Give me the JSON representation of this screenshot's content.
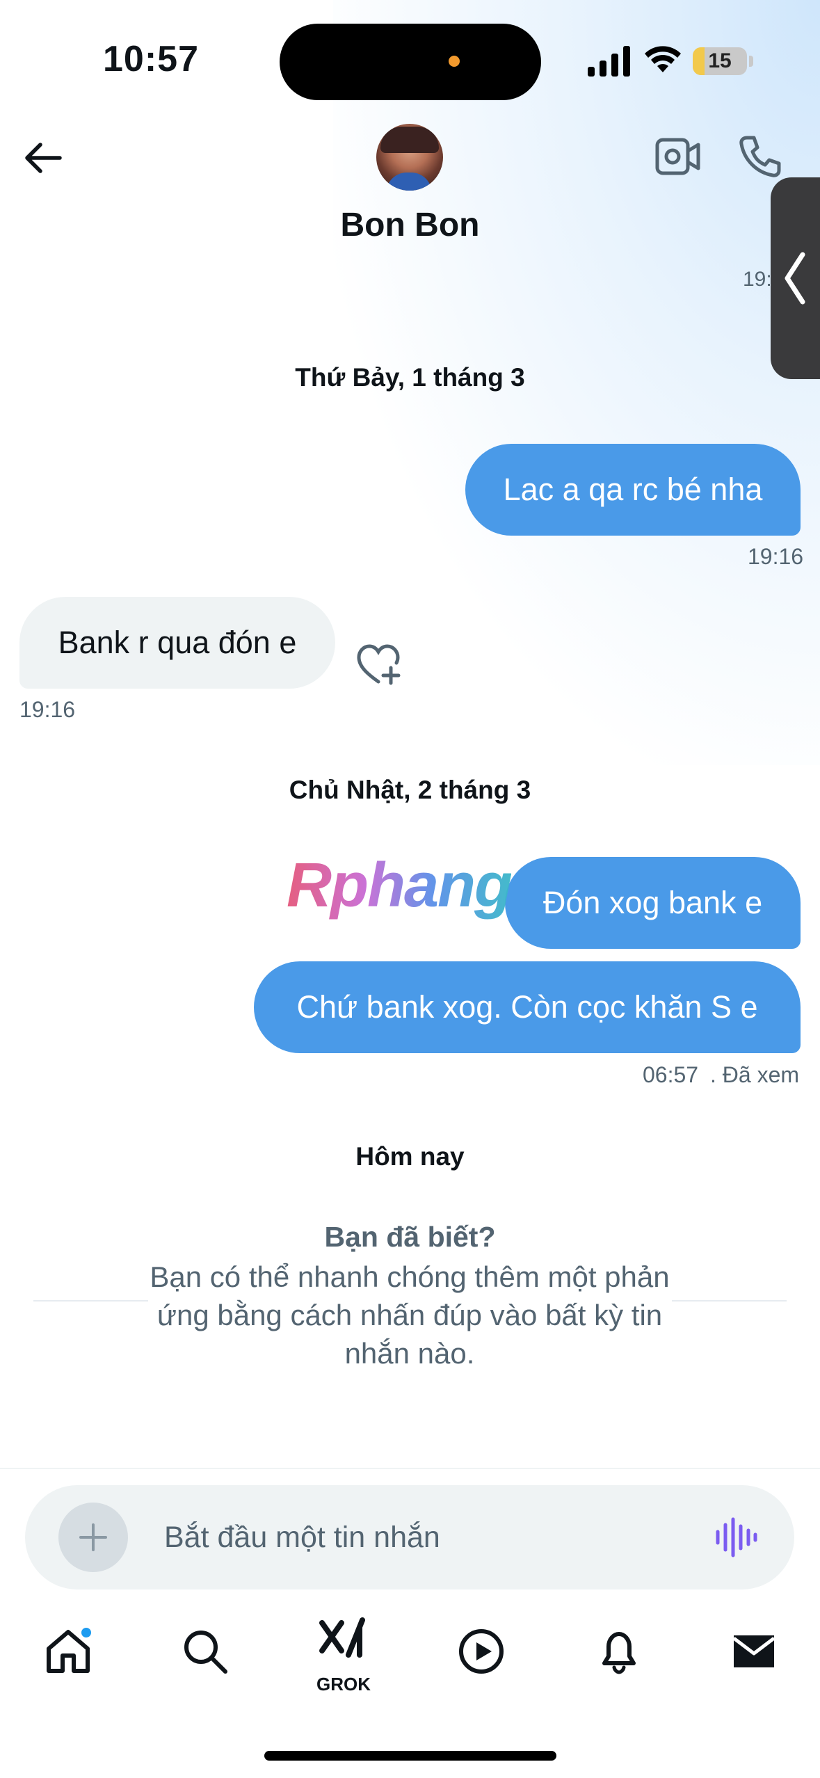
{
  "status_bar": {
    "time": "10:57",
    "battery": "15"
  },
  "header": {
    "contact_name": "Bon Bon",
    "partial_time": "19:"
  },
  "messages": {
    "day1": "Thứ Bảy, 1 tháng 3",
    "msg1": {
      "text": "Lac a qa rc bé nha",
      "time": "19:16"
    },
    "msg2": {
      "text": "Bank r qua đón e",
      "time": "19:16"
    },
    "day2": "Chủ Nhật, 2 tháng 3",
    "msg3": {
      "text": "Đón xog bank e"
    },
    "msg4": {
      "text": "Chứ bank xog. Còn cọc khăn S e",
      "time": "06:57",
      "status": ". Đã xem"
    },
    "day3": "Hôm nay"
  },
  "watermark": "Rphang",
  "tip": {
    "title": "Bạn đã biết?",
    "body": "Bạn có thể nhanh chóng thêm một phản ứng bằng cách nhấn đúp vào bất kỳ tin nhắn nào."
  },
  "composer": {
    "placeholder": "Bắt đầu một tin nhắn"
  },
  "tabbar": {
    "items": [
      "home-icon",
      "search-icon",
      "grok-icon",
      "play-icon",
      "bell-icon",
      "mail-icon"
    ],
    "grok_label": "GROK"
  },
  "colors": {
    "accent": "#1d9bf0",
    "outgoing_bubble": "#4a9ae8",
    "incoming_bubble": "#eff3f4",
    "secondary_text": "#536471"
  }
}
